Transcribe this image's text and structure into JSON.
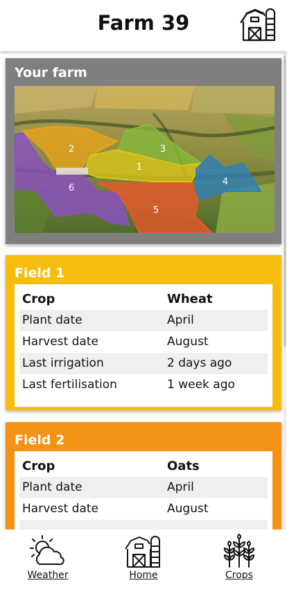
{
  "header": {
    "title": "Farm 39",
    "icon": "barn-icon"
  },
  "farm": {
    "title": "Your farm",
    "regions": [
      "1",
      "2",
      "3",
      "4",
      "5",
      "6"
    ],
    "colors": {
      "r1": "#d9c41a",
      "r2": "#e6a21b",
      "r3": "#86b83a",
      "r4": "#2f7fb8",
      "r5": "#e8572a",
      "r6": "#8b4ec4"
    }
  },
  "fields": [
    {
      "title": "Field 1",
      "color": "#f6bd0f",
      "head": {
        "key": "Crop",
        "value": "Wheat"
      },
      "rows": [
        {
          "key": "Plant date",
          "value": "April"
        },
        {
          "key": "Harvest date",
          "value": "August"
        },
        {
          "key": "Last irrigation",
          "value": "2 days ago"
        },
        {
          "key": "Last fertilisation",
          "value": "1 week ago"
        }
      ]
    },
    {
      "title": "Field 2",
      "color": "#f39214",
      "head": {
        "key": "Crop",
        "value": "Oats"
      },
      "rows": [
        {
          "key": "Plant date",
          "value": "April"
        },
        {
          "key": "Harvest date",
          "value": "August"
        }
      ]
    }
  ],
  "nav": {
    "weather": {
      "label": "Weather",
      "icon": "weather-icon"
    },
    "home": {
      "label": "Home",
      "icon": "barn-icon"
    },
    "crops": {
      "label": "Crops",
      "icon": "crops-icon"
    }
  }
}
